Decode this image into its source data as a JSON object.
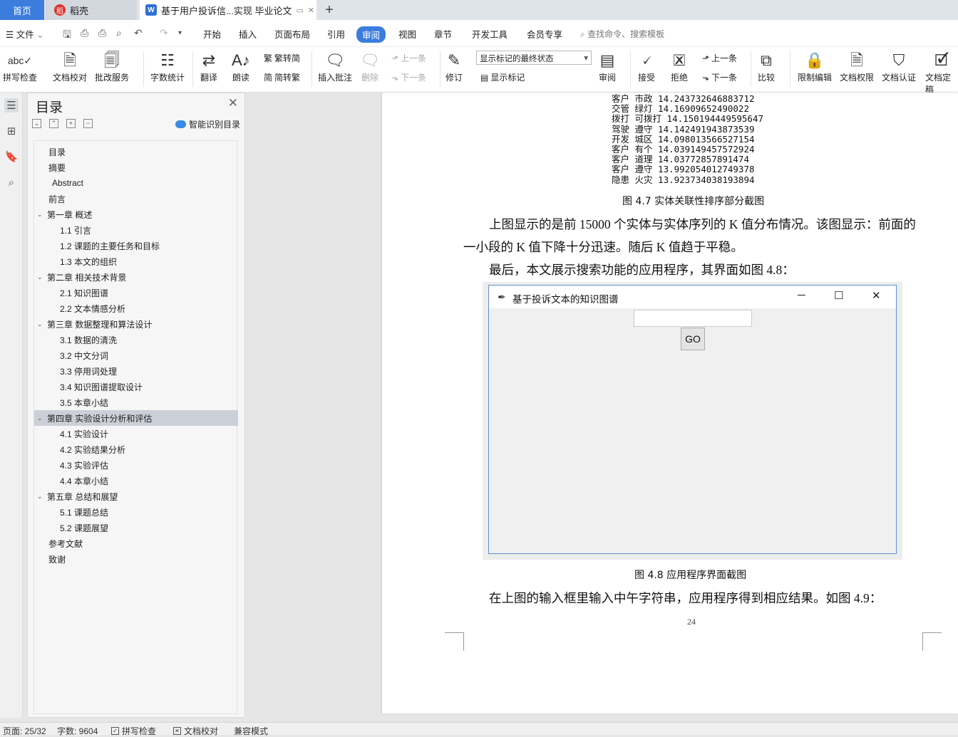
{
  "tabs": {
    "home": "首页",
    "daoke": "稻壳",
    "doc": "基于用户投诉信...实现 毕业论文",
    "new_tab": "+"
  },
  "menu": {
    "file": "文件",
    "items": [
      "开始",
      "插入",
      "页面布局",
      "引用",
      "审阅",
      "视图",
      "章节",
      "开发工具",
      "会员专享"
    ],
    "active": "审阅",
    "search_placeholder": "查找命令、搜索模板"
  },
  "ribbon": {
    "spellcheck": "拼写检查",
    "doc_proof": "文档校对",
    "annotate_service": "批改服务",
    "word_count": "字数统计",
    "translate": "翻译",
    "read_aloud": "朗读",
    "trad_to_simp": "繁转简",
    "simp_to_trad": "简转繁",
    "insert_comment": "插入批注",
    "delete": "删除",
    "prev_comment": "上一条",
    "next_comment": "下一条",
    "track_changes": "修订",
    "markup_select": "显示标记的最终状态",
    "show_markup": "显示标记",
    "review": "审阅",
    "accept": "接受",
    "reject": "拒绝",
    "prev_change": "上一条",
    "next_change": "下一条",
    "compare": "比较",
    "restrict_edit": "限制编辑",
    "doc_permission": "文档权限",
    "doc_certify": "文档认证",
    "doc_finalize": "文档定稿"
  },
  "nav": {
    "title": "目录",
    "smart_toc": "智能识别目录",
    "toc": [
      {
        "label": "目录",
        "level": 0,
        "chev": false
      },
      {
        "label": "摘要",
        "level": 0,
        "chev": false
      },
      {
        "label": "Abstract",
        "level": 0,
        "chev": false
      },
      {
        "label": "前言",
        "level": 0,
        "chev": false
      },
      {
        "label": "第一章 概述",
        "level": 0,
        "chev": true
      },
      {
        "label": "1.1 引言",
        "level": 1,
        "chev": false
      },
      {
        "label": "1.2  课题的主要任务和目标",
        "level": 1,
        "chev": false
      },
      {
        "label": "1.3 本文的组织",
        "level": 1,
        "chev": false
      },
      {
        "label": "第二章 相关技术背景",
        "level": 0,
        "chev": true
      },
      {
        "label": "2.1  知识图谱",
        "level": 1,
        "chev": false
      },
      {
        "label": "2.2 文本情感分析",
        "level": 1,
        "chev": false
      },
      {
        "label": "第三章 数据整理和算法设计",
        "level": 0,
        "chev": true
      },
      {
        "label": "3.1 数据的清洗",
        "level": 1,
        "chev": false
      },
      {
        "label": "3.2 中文分词",
        "level": 1,
        "chev": false
      },
      {
        "label": "3.3 停用词处理",
        "level": 1,
        "chev": false
      },
      {
        "label": "3.4 知识图谱提取设计",
        "level": 1,
        "chev": false
      },
      {
        "label": "3.5 本章小结",
        "level": 1,
        "chev": false
      },
      {
        "label": "第四章 实验设计分析和评估",
        "level": 0,
        "chev": true,
        "selected": true
      },
      {
        "label": "4.1 实验设计",
        "level": 1,
        "chev": false
      },
      {
        "label": "4.2 实验结果分析",
        "level": 1,
        "chev": false
      },
      {
        "label": "4.3 实验评估",
        "level": 1,
        "chev": false
      },
      {
        "label": "4.4 本章小结",
        "level": 1,
        "chev": false
      },
      {
        "label": "第五章 总结和展望",
        "level": 0,
        "chev": true
      },
      {
        "label": "5.1 课题总结",
        "level": 1,
        "chev": false
      },
      {
        "label": "5.2 课题展望",
        "level": 1,
        "chev": false
      },
      {
        "label": "参考文献",
        "level": 0,
        "chev": false
      },
      {
        "label": "致谢",
        "level": 0,
        "chev": false
      }
    ]
  },
  "document": {
    "data_lines": [
      "客户 市政 14.243732646883712",
      "交管 绿灯 14.16909652490022",
      "拨打 可拨打 14.150194449595647",
      "驾驶 遵守 14.142491943873539",
      "开发 城区 14.098013566527154",
      "客户 有个 14.039149457572924",
      "客户 道理 14.03772857891474",
      "客户 遵守 13.992054012749378",
      "隐患 火灾 13.923734038193894"
    ],
    "caption_4_7": "图 4.7    实体关联性排序部分截图",
    "para1_line1": "上图显示的是前 15000 个实体与实体序列的 K 值分布情况。该图显示：前面的",
    "para1_line2": "一小段的 K 值下降十分迅速。随后 K 值趋于平稳。",
    "para2": "最后，本文展示搜索功能的应用程序，其界面如图 4.8：",
    "app_window": {
      "title": "基于投诉文本的知识图谱",
      "input_value": "",
      "go_label": "GO"
    },
    "caption_4_8": "图 4.8 应用程序界面截图",
    "para3": "在上图的输入框里输入中午字符串，应用程序得到相应结果。如图 4.9：",
    "page_number": "24"
  },
  "status": {
    "page": "页面: 25/32",
    "words": "字数: 9604",
    "spellcheck": "拼写检查",
    "proof": "文档校对",
    "compat": "兼容模式"
  }
}
